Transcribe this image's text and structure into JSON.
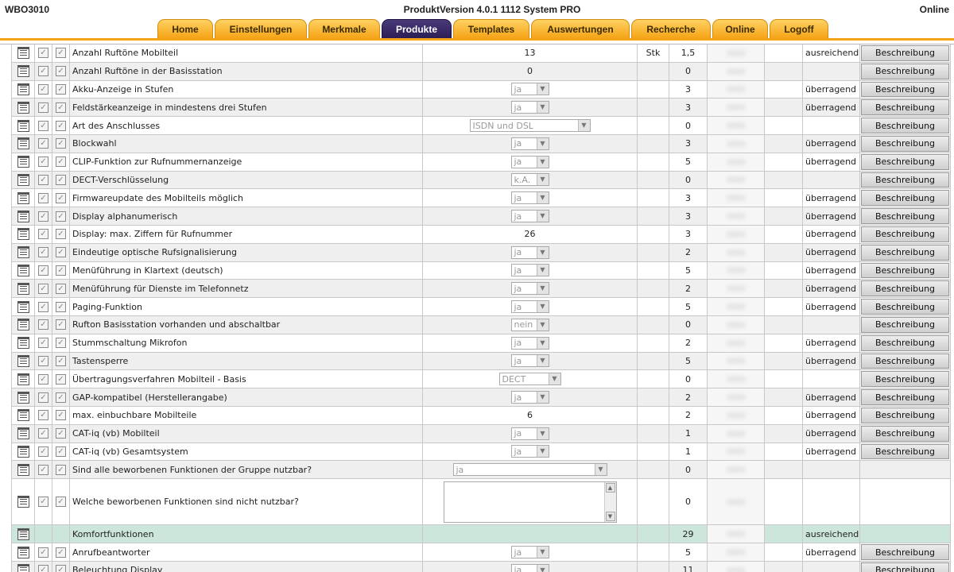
{
  "header": {
    "app_id": "WBO3010",
    "version": "ProduktVersion 4.0.1 1112 System PRO",
    "status": "Online"
  },
  "tabs": [
    {
      "label": "Home",
      "active": false
    },
    {
      "label": "Einstellungen",
      "active": false
    },
    {
      "label": "Merkmale",
      "active": false
    },
    {
      "label": "Produkte",
      "active": true
    },
    {
      "label": "Templates",
      "active": false
    },
    {
      "label": "Auswertungen",
      "active": false
    },
    {
      "label": "Recherche",
      "active": false
    },
    {
      "label": "Online",
      "active": false
    },
    {
      "label": "Logoff",
      "active": false
    }
  ],
  "button_label": "Beschreibung",
  "rows": [
    {
      "name": "Anzahl Ruftöne Mobilteil",
      "type": "text",
      "value": "13",
      "unit": "Stk",
      "score": "1,5",
      "rating": "ausreichend",
      "button": true
    },
    {
      "name": "Anzahl Ruftöne in der Basisstation",
      "type": "text",
      "value": "0",
      "unit": "",
      "score": "0",
      "rating": "",
      "button": true
    },
    {
      "name": "Akku-Anzeige in Stufen",
      "type": "select",
      "value": "ja",
      "unit": "",
      "score": "3",
      "rating": "überragend",
      "button": true
    },
    {
      "name": "Feldstärkeanzeige in mindestens drei Stufen",
      "type": "select",
      "value": "ja",
      "unit": "",
      "score": "3",
      "rating": "überragend",
      "button": true
    },
    {
      "name": "Art des Anschlusses",
      "type": "select-wide",
      "value": "ISDN und DSL",
      "unit": "",
      "score": "0",
      "rating": "",
      "button": true
    },
    {
      "name": "Blockwahl",
      "type": "select",
      "value": "ja",
      "unit": "",
      "score": "3",
      "rating": "überragend",
      "button": true
    },
    {
      "name": "CLIP-Funktion zur Rufnummernanzeige",
      "type": "select",
      "value": "ja",
      "unit": "",
      "score": "5",
      "rating": "überragend",
      "button": true
    },
    {
      "name": "DECT-Verschlüsselung",
      "type": "select",
      "value": "k.A.",
      "unit": "",
      "score": "0",
      "rating": "",
      "button": true
    },
    {
      "name": "Firmwareupdate des Mobilteils möglich",
      "type": "select",
      "value": "ja",
      "unit": "",
      "score": "3",
      "rating": "überragend",
      "button": true
    },
    {
      "name": "Display alphanumerisch",
      "type": "select",
      "value": "ja",
      "unit": "",
      "score": "3",
      "rating": "überragend",
      "button": true
    },
    {
      "name": "Display: max. Ziffern für Rufnummer",
      "type": "text",
      "value": "26",
      "unit": "",
      "score": "3",
      "rating": "überragend",
      "button": true
    },
    {
      "name": "Eindeutige optische Rufsignalisierung",
      "type": "select",
      "value": "ja",
      "unit": "",
      "score": "2",
      "rating": "überragend",
      "button": true
    },
    {
      "name": "Menüführung in Klartext (deutsch)",
      "type": "select",
      "value": "ja",
      "unit": "",
      "score": "5",
      "rating": "überragend",
      "button": true
    },
    {
      "name": "Menüführung für Dienste im Telefonnetz",
      "type": "select",
      "value": "ja",
      "unit": "",
      "score": "2",
      "rating": "überragend",
      "button": true
    },
    {
      "name": "Paging-Funktion",
      "type": "select",
      "value": "ja",
      "unit": "",
      "score": "5",
      "rating": "überragend",
      "button": true
    },
    {
      "name": "Rufton Basisstation vorhanden und abschaltbar",
      "type": "select",
      "value": "nein",
      "unit": "",
      "score": "0",
      "rating": "",
      "button": true
    },
    {
      "name": "Stummschaltung Mikrofon",
      "type": "select",
      "value": "ja",
      "unit": "",
      "score": "2",
      "rating": "überragend",
      "button": true
    },
    {
      "name": "Tastensperre",
      "type": "select",
      "value": "ja",
      "unit": "",
      "score": "5",
      "rating": "überragend",
      "button": true
    },
    {
      "name": "Übertragungsverfahren Mobilteil - Basis",
      "type": "select-mid",
      "value": "DECT",
      "unit": "",
      "score": "0",
      "rating": "",
      "button": true
    },
    {
      "name": "GAP-kompatibel (Herstellerangabe)",
      "type": "select",
      "value": "ja",
      "unit": "",
      "score": "2",
      "rating": "überragend",
      "button": true
    },
    {
      "name": "max. einbuchbare Mobilteile",
      "type": "text",
      "value": "6",
      "unit": "",
      "score": "2",
      "rating": "überragend",
      "button": true
    },
    {
      "name": "CAT-iq (vb) Mobilteil",
      "type": "select",
      "value": "ja",
      "unit": "",
      "score": "1",
      "rating": "überragend",
      "button": true
    },
    {
      "name": "CAT-iq (vb) Gesamtsystem",
      "type": "select",
      "value": "ja",
      "unit": "",
      "score": "1",
      "rating": "überragend",
      "button": true
    },
    {
      "name": "Sind alle beworbenen Funktionen der Gruppe nutzbar?",
      "type": "select-xwide",
      "value": "ja",
      "unit": "",
      "score": "0",
      "rating": "",
      "button": false
    },
    {
      "name": "Welche beworbenen Funktionen sind nicht nutzbar?",
      "type": "textarea",
      "value": "",
      "unit": "",
      "score": "0",
      "rating": "",
      "button": false
    },
    {
      "name": "Komfortfunktionen",
      "type": "group",
      "value": "",
      "unit": "",
      "score": "29",
      "rating": "ausreichend",
      "button": false
    },
    {
      "name": "Anrufbeantworter",
      "type": "select",
      "value": "ja",
      "unit": "",
      "score": "5",
      "rating": "überragend",
      "button": true
    },
    {
      "name": "Beleuchtung Display",
      "type": "select",
      "value": "ja",
      "unit": "",
      "score": "11",
      "rating": "",
      "button": true
    }
  ]
}
